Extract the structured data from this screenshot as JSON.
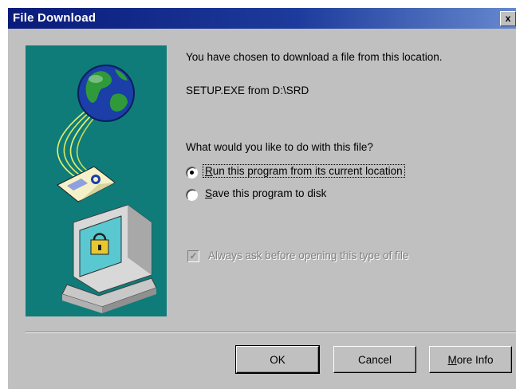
{
  "window": {
    "title": "File Download",
    "close_glyph": "x"
  },
  "message": {
    "line1": "You have chosen to download a file from this location.",
    "file_line": "SETUP.EXE from D:\\SRD",
    "question": "What would you like to do with this file?"
  },
  "options": [
    {
      "accel": "R",
      "rest": "un this program from its current location",
      "selected": true
    },
    {
      "accel": "S",
      "rest": "ave this program to disk",
      "selected": false
    }
  ],
  "checkbox": {
    "label": "Always ask before opening this type of file",
    "checked": true,
    "enabled": false
  },
  "buttons": {
    "ok": "OK",
    "cancel": "Cancel",
    "more_info_accel": "M",
    "more_info_rest": "ore Info"
  },
  "icons": {
    "globe": "globe-icon",
    "document": "document-icon",
    "computer": "computer-icon",
    "lock": "lock-icon"
  },
  "colors": {
    "title_start": "#0a1b7a",
    "title_end": "#6c8fd2",
    "panel_teal": "#0f7c7a",
    "dialog_gray": "#c0c0c0"
  }
}
